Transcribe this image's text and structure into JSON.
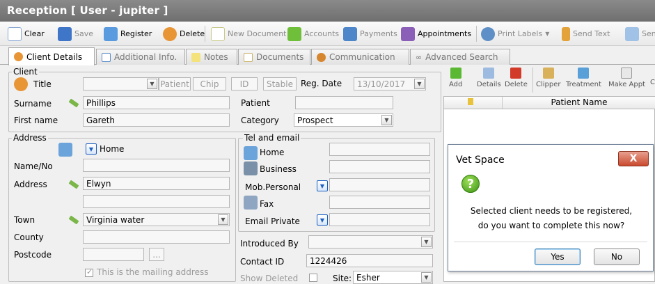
{
  "window": {
    "title": "Reception  [ User - jupiter ]"
  },
  "toolbar": {
    "items": [
      {
        "label": "Clear",
        "icon": "clear-doc-icon",
        "enabled": true
      },
      {
        "label": "Save",
        "icon": "save-disk-icon",
        "enabled": false
      },
      {
        "label": "Register",
        "icon": "register-pencil-icon",
        "enabled": true
      },
      {
        "label": "Delete",
        "icon": "delete-user-icon",
        "enabled": true
      },
      {
        "label": "New Document",
        "icon": "new-document-icon",
        "enabled": false
      },
      {
        "label": "Accounts",
        "icon": "accounts-icon",
        "enabled": false
      },
      {
        "label": "Payments",
        "icon": "payments-icon",
        "enabled": false
      },
      {
        "label": "Appointments",
        "icon": "calendar-icon",
        "enabled": true
      },
      {
        "label": "Print Labels",
        "icon": "print-labels-icon",
        "enabled": false
      },
      {
        "label": "Send Text",
        "icon": "phone-icon",
        "enabled": false
      },
      {
        "label": "Send",
        "icon": "send-icon",
        "enabled": false
      }
    ]
  },
  "tabs": [
    {
      "label": "Client Details",
      "active": true
    },
    {
      "label": "Additional Info.",
      "active": false
    },
    {
      "label": "Notes",
      "active": false
    },
    {
      "label": "Documents",
      "active": false
    },
    {
      "label": "Communication",
      "active": false
    },
    {
      "label": "Advanced Search",
      "active": false
    }
  ],
  "client": {
    "group_label": "Client",
    "title_label": "Title",
    "chips": [
      "Patient",
      "Chip",
      "ID",
      "Stable"
    ],
    "reg_date_label": "Reg. Date",
    "reg_date": "13/10/2017",
    "surname_label": "Surname",
    "surname": "Phillips",
    "firstname_label": "First name",
    "firstname": "Gareth",
    "patient_label": "Patient",
    "category_label": "Category",
    "category": "Prospect"
  },
  "address": {
    "group_label": "Address",
    "type": "Home",
    "name_no_label": "Name/No",
    "address_label": "Address",
    "address_line1": "Elwyn",
    "town_label": "Town",
    "town": "Virginia water",
    "county_label": "County",
    "postcode_label": "Postcode",
    "postcode_button": "...",
    "mailing_label": "This is the mailing address",
    "mailing_checked": true
  },
  "tel": {
    "group_label": "Tel and email",
    "home_label": "Home",
    "business_label": "Business",
    "mob_label": "Mob.Personal",
    "fax_label": "Fax",
    "email_label": "Email Private"
  },
  "misc": {
    "introduced_by_label": "Introduced By",
    "contact_id_label": "Contact ID",
    "contact_id": "1224426",
    "show_deleted_label": "Show Deleted",
    "site_label": "Site:",
    "site": "Esher"
  },
  "patient_panel": {
    "tools": [
      "Add",
      "Details",
      "Delete",
      "Clipper",
      "Treatment",
      "Make Appt",
      "C"
    ],
    "column_header": "Patient Name"
  },
  "dialog": {
    "title": "Vet Space",
    "close_label": "X",
    "message_line1": "Selected client needs to be registered,",
    "message_line2": "do you want to complete this now?",
    "yes_label": "Yes",
    "no_label": "No"
  },
  "colors": {
    "titlebar": "#7d7d7d",
    "dialog_close": "#c94a2e",
    "dropdown_accent": "#1b5fbf"
  }
}
